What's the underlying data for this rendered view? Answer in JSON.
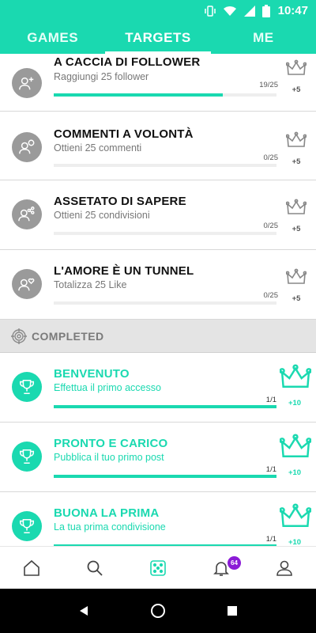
{
  "status_bar": {
    "time": "10:47"
  },
  "tabs": [
    {
      "label": "GAMES",
      "active": false
    },
    {
      "label": "TARGETS",
      "active": true
    },
    {
      "label": "ME",
      "active": false
    }
  ],
  "targets": [
    {
      "title": "A CACCIA DI FOLLOWER",
      "subtitle": "Raggiungi 25 follower",
      "count": "19/25",
      "progress": 0.76,
      "reward": "+5",
      "icon": "add-user-icon"
    },
    {
      "title": "COMMENTI A VOLONTÀ",
      "subtitle": "Ottieni 25 commenti",
      "count": "0/25",
      "progress": 0,
      "reward": "+5",
      "icon": "user-comment-icon"
    },
    {
      "title": "ASSETATO DI SAPERE",
      "subtitle": "Ottieni 25 condivisioni",
      "count": "0/25",
      "progress": 0,
      "reward": "+5",
      "icon": "user-share-icon"
    },
    {
      "title": "L'AMORE È UN TUNNEL",
      "subtitle": "Totalizza 25 Like",
      "count": "0/25",
      "progress": 0,
      "reward": "+5",
      "icon": "user-heart-icon"
    }
  ],
  "completed_section": {
    "label": "COMPLETED",
    "icon": "target-icon"
  },
  "completed": [
    {
      "title": "BENVENUTO",
      "subtitle": "Effettua il primo accesso",
      "count": "1/1",
      "progress": 1,
      "reward": "+10",
      "icon": "trophy-icon"
    },
    {
      "title": "PRONTO E CARICO",
      "subtitle": "Pubblica il tuo primo post",
      "count": "1/1",
      "progress": 1,
      "reward": "+10",
      "icon": "trophy-icon"
    },
    {
      "title": "BUONA LA PRIMA",
      "subtitle": "La tua prima condivisione",
      "count": "1/1",
      "progress": 1,
      "reward": "+10",
      "icon": "trophy-icon"
    }
  ],
  "bottom_nav": {
    "items": [
      "home-icon",
      "search-icon",
      "dice-icon",
      "bell-icon",
      "profile-icon"
    ],
    "notification_badge": "64"
  },
  "colors": {
    "accent": "#1ad9b0",
    "badge": "#8b1bd6",
    "inactive_avatar": "#9a9a9a"
  }
}
